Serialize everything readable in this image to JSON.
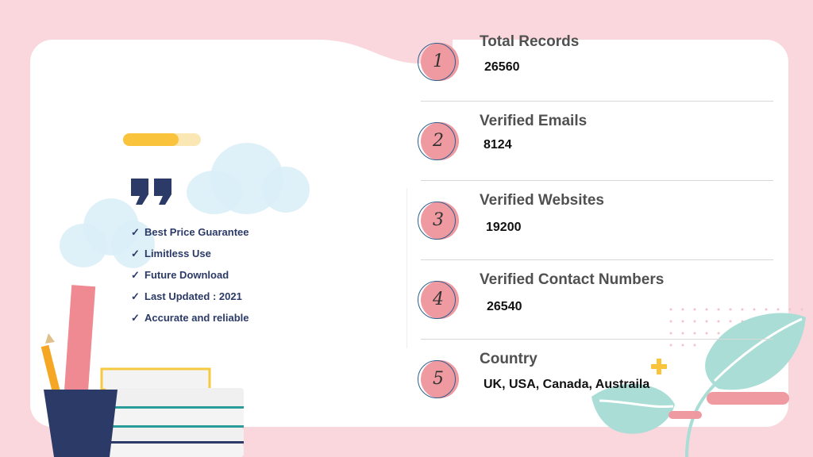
{
  "checklist": [
    "Best Price Guarantee",
    "Limitless Use",
    "Future Download",
    "Last Updated : 2021",
    "Accurate and reliable"
  ],
  "items": [
    {
      "number": "1",
      "title": "Total Records",
      "value": "26560"
    },
    {
      "number": "2",
      "title": "Verified Emails",
      "value": "8124"
    },
    {
      "number": "3",
      "title": "Verified Websites",
      "value": "19200"
    },
    {
      "number": "4",
      "title": "Verified Contact Numbers",
      "value": "26540"
    },
    {
      "number": "5",
      "title": "Country",
      "value": "UK, USA, Canada, Austraila"
    }
  ],
  "colors": {
    "background": "#f9d7dc",
    "accent_pink": "#ef9aa0",
    "navy": "#2b3a67",
    "yellow": "#f9c43c",
    "mint": "#a9ddd6"
  }
}
